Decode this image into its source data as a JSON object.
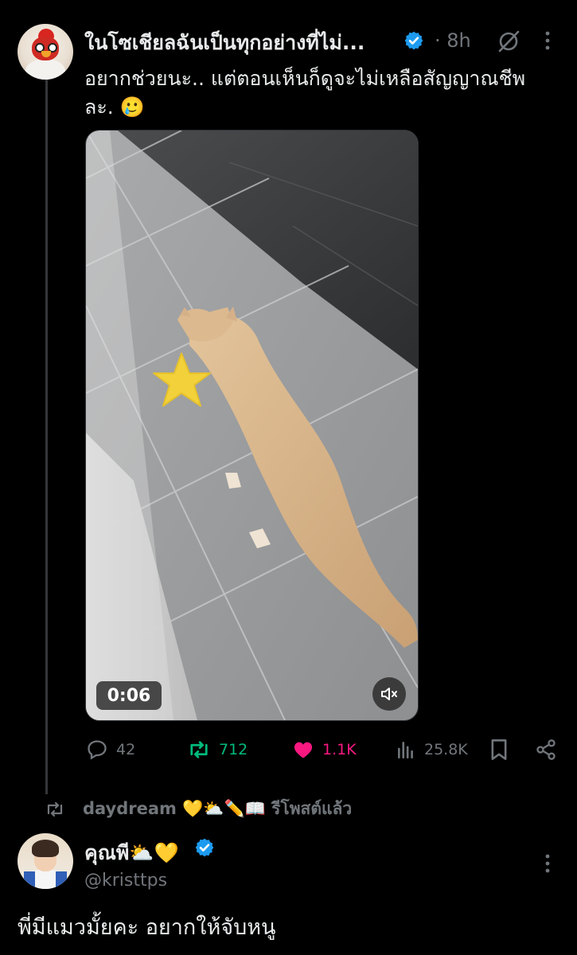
{
  "post": {
    "author_name": "ในโซเชียลฉันเป็นทุกอย่างที่ไม่...",
    "time": "· 8h",
    "text": "อยากช่วยนะ.. แต่ตอนเห็นก็ดูจะไม่เหลือสัญญาณชีพละ. 🥲",
    "video": {
      "duration": "0:06",
      "muted": true
    },
    "metrics": {
      "replies": "42",
      "reposts": "712",
      "likes": "1.1K",
      "views": "25.8K"
    }
  },
  "repost_context": {
    "text": "daydream 💛⛅✏️📖 รีโพสต์แล้ว"
  },
  "reply": {
    "author_name": "คุณพี⛅💛",
    "handle": "@kristtps",
    "text": "พี่มีแมวมั้ยคะ อยากให้จับหนู"
  },
  "colors": {
    "background": "#000000",
    "text": "#e7e9ea",
    "muted": "#71767b",
    "verified": "#1d9bf0",
    "repost_green": "#00ba7c",
    "like_pink": "#f91880"
  },
  "icons": [
    "verified-badge-icon",
    "grok-slash-icon",
    "more-icon",
    "reply-icon",
    "repost-icon",
    "heart-icon",
    "views-icon",
    "bookmark-icon",
    "share-icon",
    "mute-icon"
  ]
}
